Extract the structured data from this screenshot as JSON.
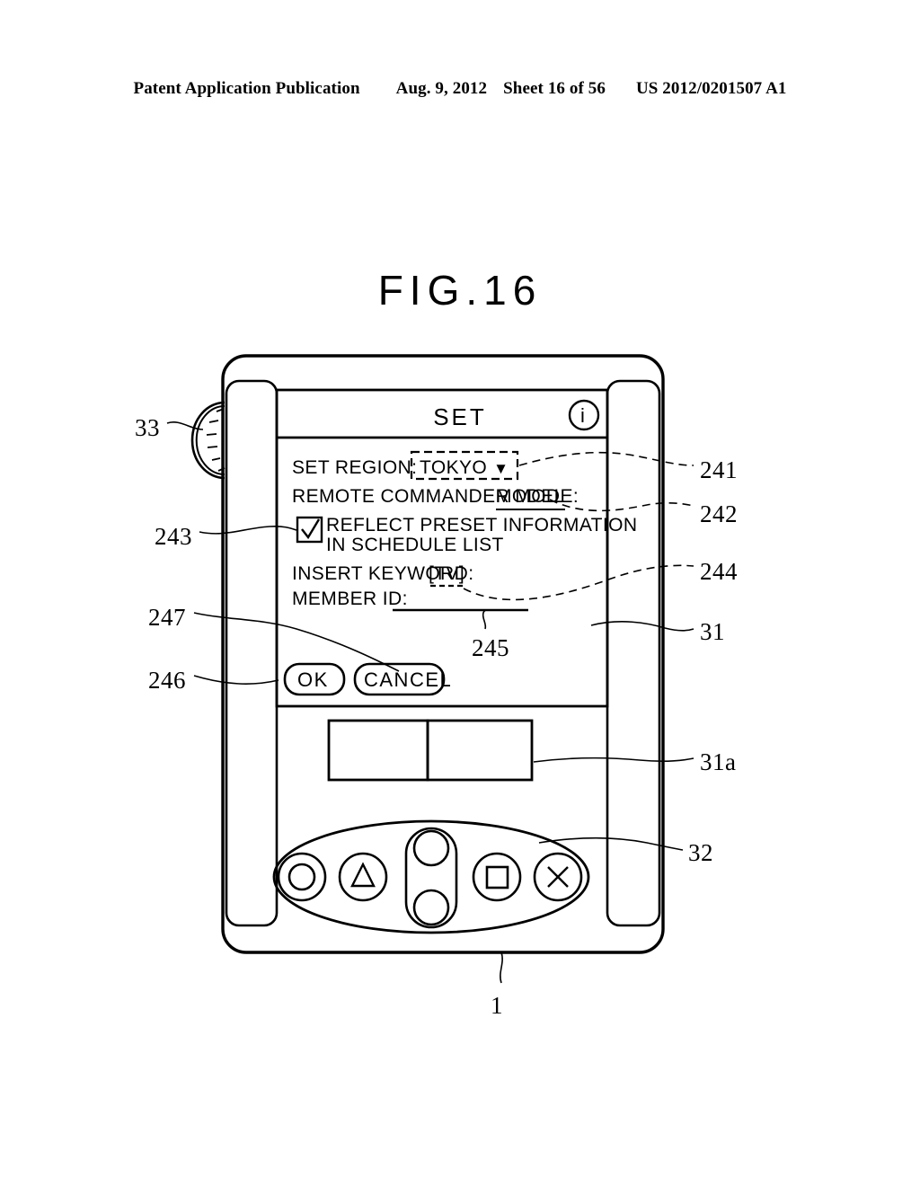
{
  "page_header": {
    "publication": "Patent Application Publication",
    "date": "Aug. 9, 2012",
    "sheet": "Sheet 16 of 56",
    "doc_number": "US 2012/0201507 A1"
  },
  "figure": {
    "title": "FIG.16"
  },
  "device_screen": {
    "titlebar": {
      "title": "SET",
      "info_icon": "info-circle-icon",
      "info_glyph": "i"
    },
    "fields": {
      "region_label": "SET REGION:",
      "region_value": "TOKYO",
      "region_dropdown_glyph": "▼",
      "remote_mode_label": "REMOTE COMMANDER MODE:",
      "remote_mode_value": "MODEL",
      "checkbox_checked": true,
      "checkbox_glyph": "✓",
      "checkbox_line1": "REFLECT PRESET INFORMATION",
      "checkbox_line2": "IN SCHEDULE LIST",
      "keyword_label": "INSERT KEYWORD:",
      "keyword_value": "[TV]",
      "member_id_label": "MEMBER ID:",
      "member_id_value": ""
    },
    "buttons": {
      "ok": "OK",
      "cancel": "CANCEL"
    }
  },
  "reference_numerals": {
    "jog_dial": "33",
    "checkbox": "243",
    "cancel_button": "247",
    "ok_button": "246",
    "member_id_field": "245",
    "region_field": "241",
    "remote_mode_field": "242",
    "keyword_field": "244",
    "display_panel": "31",
    "softkey_area": "31a",
    "button_cluster": "32",
    "device": "1"
  },
  "colors": {
    "ink": "#000000",
    "paper": "#ffffff"
  }
}
